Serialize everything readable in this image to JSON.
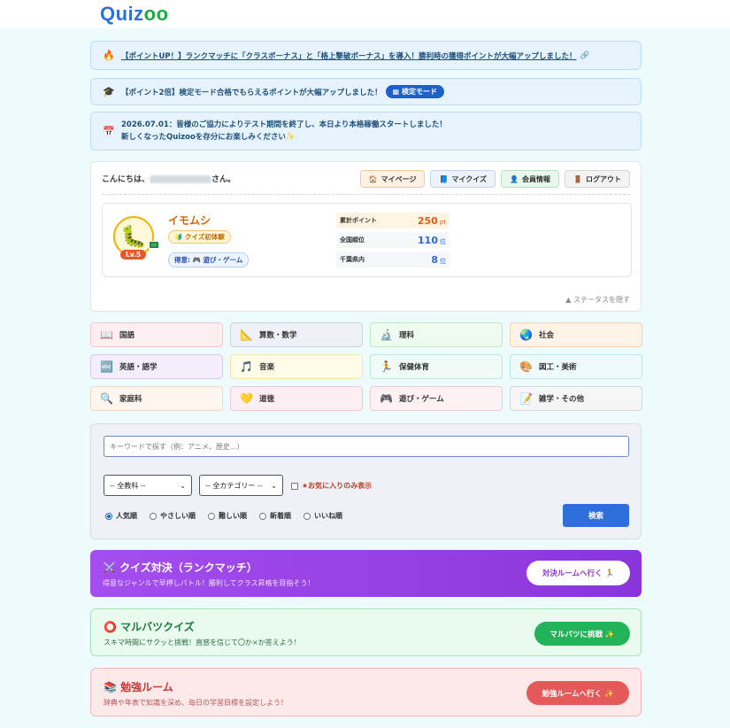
{
  "logo": {
    "part1": "Quiz",
    "part2": "oo"
  },
  "notices": [
    {
      "icon": "🔥",
      "text": "【ポイントUP！】ランクマッチに「クラスボーナス」と「格上撃破ボーナス」を導入！勝利時の獲得ポイントが大幅アップしました！",
      "link_icon": "🔗"
    },
    {
      "icon": "🎓",
      "text": "【ポイント2倍】検定モード合格でもらえるポイントが大幅アップしました！",
      "pill": "検定モード",
      "pill_icon": "▦"
    },
    {
      "icon": "📅",
      "line1": "2026.07.01：皆様のご協力によりテスト期間を終了し、本日より本格稼働スタートしました！",
      "line2": "新しくなったQuizooを存分にお楽しみください✨"
    }
  ],
  "user": {
    "greeting_prefix": "こんにちは、",
    "greeting_suffix": "さん。",
    "nav": [
      {
        "icon": "🏠",
        "label": "マイページ"
      },
      {
        "icon": "📘",
        "label": "マイクイズ"
      },
      {
        "icon": "👤",
        "label": "会員情報"
      },
      {
        "icon": "🚪",
        "label": "ログアウト"
      }
    ],
    "character_name": "イモムシ",
    "level": "Lv.5",
    "flag": "▭",
    "rank_badge": "🔰 クイズ初体験",
    "favorite_badge": "得意: 🎮 遊び・ゲーム",
    "stats": [
      {
        "label": "累計ポイント",
        "value": "250",
        "unit": "pt"
      },
      {
        "label": "全国順位",
        "value": "110",
        "unit": "位"
      },
      {
        "label": "千葉県内",
        "value": "8",
        "unit": "位"
      }
    ],
    "hide_status": "▲ ステータスを隠す"
  },
  "subjects": [
    {
      "icon": "📖",
      "label": "国語",
      "bg": "#fdeef0",
      "border": "#f3c6cc"
    },
    {
      "icon": "📐",
      "label": "算数・数学",
      "bg": "#eef1f7",
      "border": "#c9d3e4"
    },
    {
      "icon": "🔬",
      "label": "理科",
      "bg": "#eefbef",
      "border": "#bfe8c6"
    },
    {
      "icon": "🌏",
      "label": "社会",
      "bg": "#fff3e8",
      "border": "#f4d2b0"
    },
    {
      "icon": "🔤",
      "label": "英語・語学",
      "bg": "#f4eefc",
      "border": "#d8c8f1"
    },
    {
      "icon": "🎵",
      "label": "音楽",
      "bg": "#fffbe6",
      "border": "#f1e6a8"
    },
    {
      "icon": "🏃",
      "label": "保健体育",
      "bg": "#eefbf6",
      "border": "#bfe8d6"
    },
    {
      "icon": "🎨",
      "label": "図工・美術",
      "bg": "#eefbfc",
      "border": "#bde6ea"
    },
    {
      "icon": "🔍",
      "label": "家庭科",
      "bg": "#fff6ef",
      "border": "#f3d5bd"
    },
    {
      "icon": "💛",
      "label": "道徳",
      "bg": "#fdeef3",
      "border": "#f3c6d5"
    },
    {
      "icon": "🎮",
      "label": "遊び・ゲーム",
      "bg": "#fdf1f4",
      "border": "#f0cbd5"
    },
    {
      "icon": "📝",
      "label": "雑学・その他",
      "bg": "#f6f6f7",
      "border": "#d8d8dc"
    }
  ],
  "search": {
    "placeholder": "キーワードで探す（例：アニメ、歴史...）",
    "subject_select": "-- 全教科 --",
    "category_select": "-- 全カテゴリー --",
    "favorites_only": "★お気に入りのみ表示",
    "sorts": [
      "人気順",
      "やさしい順",
      "難しい順",
      "新着順",
      "いいね順"
    ],
    "submit": "検索"
  },
  "banners": [
    {
      "icon": "⚔️",
      "title": "クイズ対決（ランクマッチ）",
      "desc": "得意なジャンルで早押しバトル！勝利してクラス昇格を目指そう！",
      "button": "対決ルームへ行く 🏃"
    },
    {
      "icon": "⭕",
      "title": "マルバツクイズ",
      "desc": "スキマ時間にサクッと挑戦！直感を信じて〇か×か答えよう！",
      "button": "マルバツに挑戦 ✨"
    },
    {
      "icon": "📚",
      "title": "勉強ルーム",
      "desc": "辞典や年表で知識を深め、毎日の学習目標を設定しよう！",
      "button": "勉強ルームへ行く ✨"
    }
  ],
  "colors": {
    "accent": "#2f6fdc",
    "brand_green": "#22a745",
    "ranked": "#9b45e8",
    "maru": "#22b25a",
    "study": "#e45a5a"
  }
}
